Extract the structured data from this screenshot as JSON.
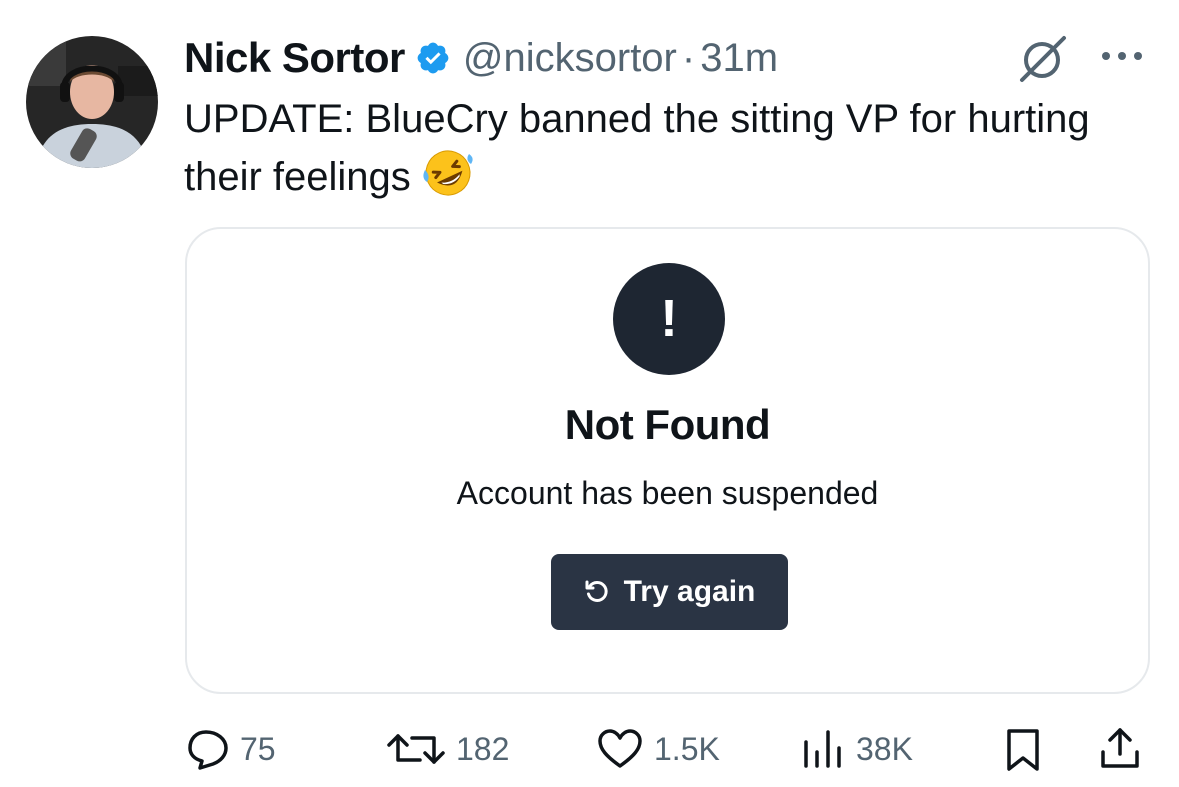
{
  "tweet": {
    "author_name": "Nick Sortor",
    "handle": "@nicksortor",
    "separator": "·",
    "time": "31m",
    "text": "UPDATE: BlueCry banned the sitting VP for hurting their feelings",
    "emoji": "rolling-on-floor-laughing-emoji",
    "verified": true
  },
  "card": {
    "alert_symbol": "!",
    "title": "Not Found",
    "message": "Account has been suspended",
    "button_label": "Try again"
  },
  "actions": {
    "replies": "75",
    "reposts": "182",
    "likes": "1.5K",
    "views": "38K"
  },
  "colors": {
    "verified_blue": "#1d9bf0",
    "secondary_text": "#536471",
    "card_button": "#2a3444",
    "alert_circle": "#1e2632"
  },
  "icons": [
    "grok-icon",
    "more-icon",
    "reply-icon",
    "repost-icon",
    "like-icon",
    "views-icon",
    "bookmark-icon",
    "share-icon"
  ]
}
